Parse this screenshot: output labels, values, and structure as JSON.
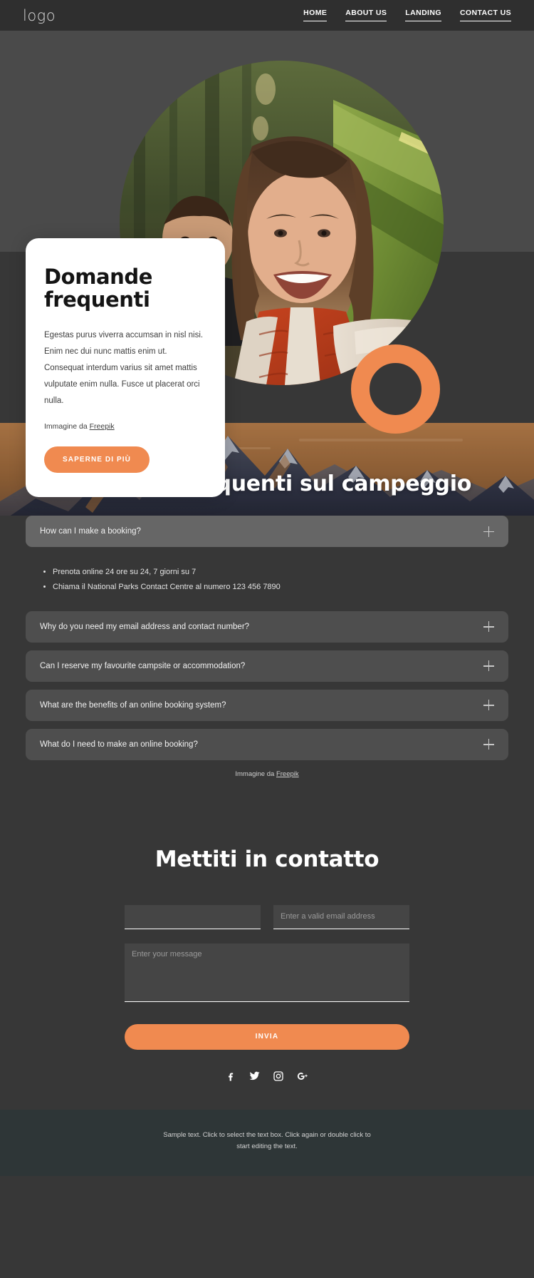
{
  "header": {
    "logo": "logo",
    "nav": [
      {
        "label": "HOME"
      },
      {
        "label": "ABOUT US"
      },
      {
        "label": "LANDING"
      },
      {
        "label": "CONTACT US"
      }
    ]
  },
  "hero": {
    "card": {
      "title": "Domande frequenti",
      "body": "Egestas purus viverra accumsan in nisl nisi. Enim nec dui nunc mattis enim ut. Consequat interdum varius sit amet mattis vulputate enim nulla. Fusce ut placerat orci nulla.",
      "credit_prefix": "Immagine da ",
      "credit_link": "Freepik",
      "button": "SAPERNE DI PIÙ"
    },
    "accent_color": "#f08a50",
    "photo_alt": "smiling-couple-camping-selfie"
  },
  "banner": {
    "title": "Domande frequenti sul campeggio",
    "image_alt": "mountain-range-at-sunset"
  },
  "faq": {
    "items": [
      {
        "question": "How can I make a booking?",
        "open": true,
        "answers": [
          "Prenota online 24 ore su 24, 7 giorni su 7",
          "Chiama il National Parks Contact Centre al numero 123 456 7890"
        ]
      },
      {
        "question": "Why do you need my email address and contact number?",
        "open": false,
        "answers": []
      },
      {
        "question": "Can I reserve my favourite campsite or accommodation?",
        "open": false,
        "answers": []
      },
      {
        "question": "What are the benefits of an online booking system?",
        "open": false,
        "answers": []
      },
      {
        "question": "What do I need to make an online booking?",
        "open": false,
        "answers": []
      }
    ],
    "credit_prefix": "Immagine da ",
    "credit_link": "Freepik"
  },
  "contact": {
    "title": "Mettiti in contatto",
    "name_value": "",
    "name_placeholder": "",
    "email_value": "",
    "email_placeholder": "Enter a valid email address",
    "message_value": "",
    "message_placeholder": "Enter your message",
    "submit_label": "INVIA",
    "socials": [
      {
        "name": "facebook-icon"
      },
      {
        "name": "twitter-icon"
      },
      {
        "name": "instagram-icon"
      },
      {
        "name": "google-plus-icon"
      }
    ]
  },
  "footer": {
    "text": "Sample text. Click to select the text box. Click again or double click to start editing the text."
  }
}
